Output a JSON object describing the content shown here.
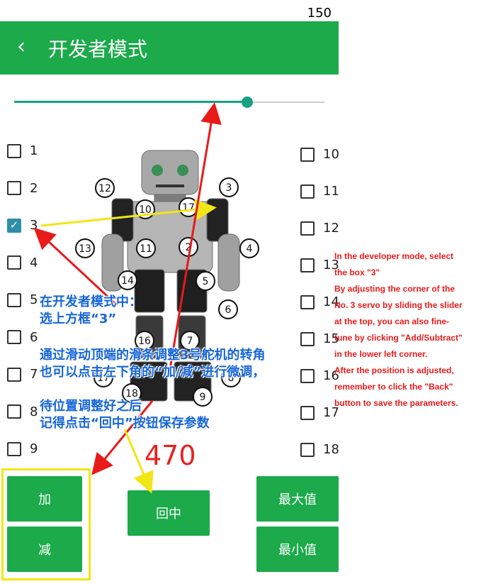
{
  "status": {
    "number": "150"
  },
  "header": {
    "back_glyph": "‹",
    "title": "开发者模式"
  },
  "slider": {
    "value_fraction": 0.75
  },
  "checkboxes_left": [
    {
      "label": "1",
      "checked": false
    },
    {
      "label": "2",
      "checked": false
    },
    {
      "label": "3",
      "checked": true
    },
    {
      "label": "4",
      "checked": false
    },
    {
      "label": "5",
      "checked": false
    },
    {
      "label": "6",
      "checked": false
    },
    {
      "label": "7",
      "checked": false
    },
    {
      "label": "8",
      "checked": false
    },
    {
      "label": "9",
      "checked": false
    }
  ],
  "checkboxes_right": [
    {
      "label": "10",
      "checked": false
    },
    {
      "label": "11",
      "checked": false
    },
    {
      "label": "12",
      "checked": false
    },
    {
      "label": "13",
      "checked": false
    },
    {
      "label": "14",
      "checked": false
    },
    {
      "label": "15",
      "checked": false
    },
    {
      "label": "16",
      "checked": false
    },
    {
      "label": "17",
      "checked": false
    },
    {
      "label": "18",
      "checked": false
    }
  ],
  "robot_servo_numbers": [
    "12",
    "10",
    "17",
    "3",
    "13",
    "11",
    "2",
    "4",
    "14",
    "5",
    "6",
    "16",
    "7",
    "8",
    "17",
    "18",
    "9"
  ],
  "servo_value": "470",
  "buttons": {
    "add": "加",
    "subtract": "减",
    "center": "回中",
    "max": "最大值",
    "min": "最小值"
  },
  "annotations_zh": [
    "在开发者模式中：",
    "选上方框“3”",
    "通过滑动顶端的滑条调整3号舵机的转角",
    "也可以点击左下角的“加/减”进行微调，",
    "待位置调整好之后",
    "记得点击“回中”按钮保存参数"
  ],
  "annotations_en": [
    "In the developer mode, select",
    "the box \"3\"",
    "By adjusting the corner of the",
    "No. 3 servo by sliding the slider",
    "at the top, you can also fine-",
    "tune by clicking \"Add/Subtract\"",
    "in the lower left corner.",
    "After the position is adjusted,",
    "remember to click the \"Back\"",
    "button to save the parameters."
  ],
  "colors": {
    "primary": "#1caa4b",
    "accent": "#16a085",
    "annotation_red": "#e81a1a",
    "annotation_blue": "#1666d8",
    "highlight_yellow": "#f1e616"
  }
}
